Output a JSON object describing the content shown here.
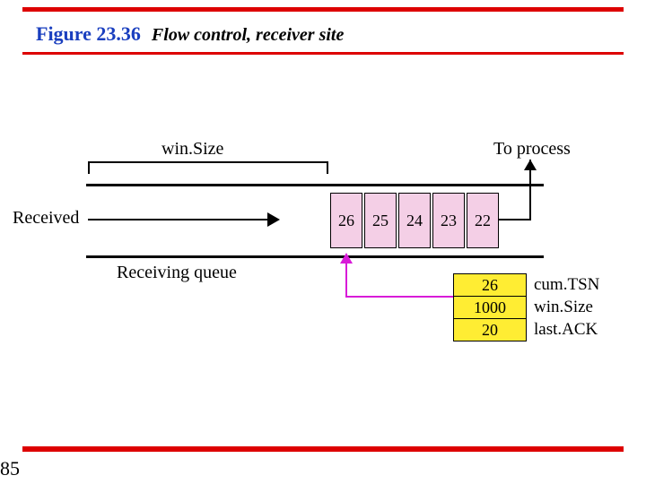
{
  "figure": {
    "number": "Figure 23.36",
    "title": "Flow control, receiver site"
  },
  "pageNumber": "85",
  "labels": {
    "winSize": "win.Size",
    "toProcess": "To process",
    "received": "Received",
    "receivingQueue": "Receiving queue"
  },
  "cells": [
    "26",
    "25",
    "24",
    "23",
    "22"
  ],
  "table": {
    "values": [
      "26",
      "1000",
      "20"
    ],
    "names": [
      "cum.TSN",
      "win.Size",
      "last.ACK"
    ]
  },
  "chart_data": {
    "type": "table",
    "title": "Flow control, receiver site",
    "queue_contents_tsn": [
      26,
      25,
      24,
      23,
      22
    ],
    "receiver_state": {
      "cumTSN": 26,
      "winSize": 1000,
      "lastACK": 20
    },
    "winSize_bracket_region": "empty positions left of TSN 26",
    "arrows": {
      "received": "into left of queue",
      "to_process": "out of right of queue"
    }
  }
}
